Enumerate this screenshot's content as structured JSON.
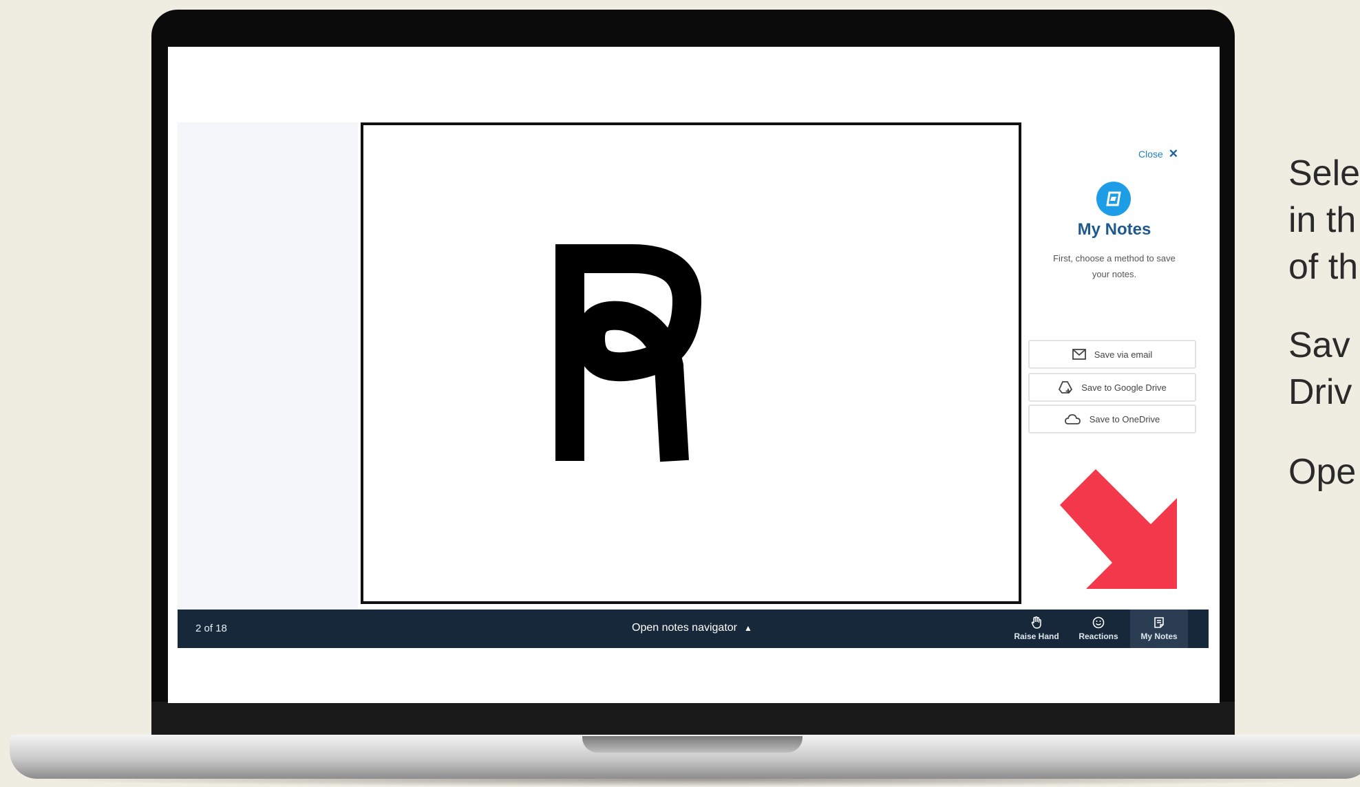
{
  "side_text": {
    "line1": "Sele",
    "line2": "in th",
    "line3": "of th",
    "line4": "Sav",
    "line5": "Driv",
    "line6": "Ope"
  },
  "slide": {
    "logo_letter": "R"
  },
  "notes_panel": {
    "close_label": "Close",
    "close_icon": "✕",
    "title": "My Notes",
    "description": "First, choose a method to save your notes.",
    "buttons": [
      {
        "label": "Save via email",
        "icon": "mail-icon"
      },
      {
        "label": "Save to Google Drive",
        "icon": "google-drive-icon"
      },
      {
        "label": "Save to OneDrive",
        "icon": "cloud-icon"
      }
    ]
  },
  "toolbar": {
    "slide_count": "2 of 18",
    "navigator_label": "Open notes navigator",
    "navigator_icon": "▲",
    "buttons": [
      {
        "label": "Raise Hand",
        "icon": "hand-icon"
      },
      {
        "label": "Reactions",
        "icon": "smiley-icon"
      },
      {
        "label": "My Notes",
        "icon": "notes-icon",
        "active": true
      }
    ]
  },
  "colors": {
    "background": "#efede2",
    "toolbar": "#17283b",
    "accent": "#1c9de6",
    "title": "#1e5a8c",
    "arrow": "#f2384a"
  }
}
